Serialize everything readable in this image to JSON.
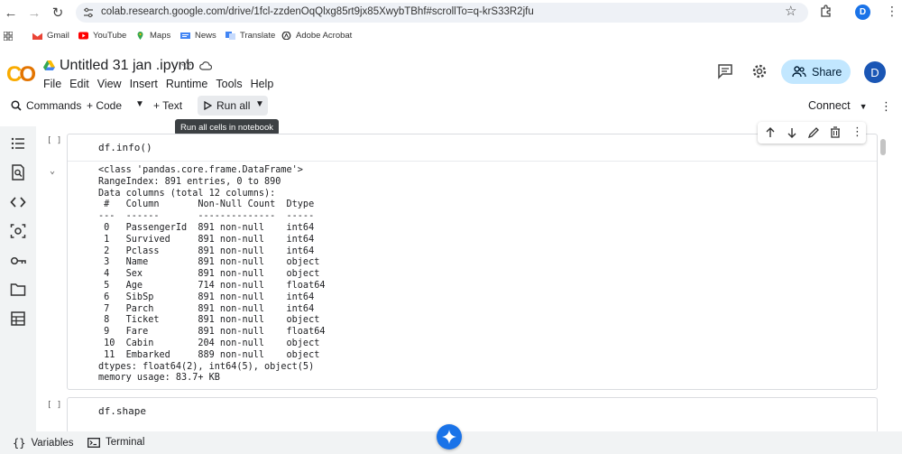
{
  "browser": {
    "url": "colab.research.google.com/drive/1fcl-zzdenOqQlxg85rt9jx85XwybTBhf#scrollTo=q-krS33R2jfu",
    "profile_initial": "D"
  },
  "bookmarks": [
    {
      "label": "Gmail",
      "icon": "gmail-icon"
    },
    {
      "label": "YouTube",
      "icon": "youtube-icon"
    },
    {
      "label": "Maps",
      "icon": "maps-icon"
    },
    {
      "label": "News",
      "icon": "news-icon"
    },
    {
      "label": "Translate",
      "icon": "translate-icon"
    },
    {
      "label": "Adobe Acrobat",
      "icon": "acrobat-icon"
    }
  ],
  "colab": {
    "logo_text": "CO",
    "title": "Untitled 31 jan .ipynb",
    "menu": [
      "File",
      "Edit",
      "View",
      "Insert",
      "Runtime",
      "Tools",
      "Help"
    ],
    "share_label": "Share",
    "user_initial": "D"
  },
  "toolbar": {
    "commands_label": "Commands",
    "code_label": "+ Code",
    "text_label": "+ Text",
    "run_all_label": "Run all",
    "tooltip": "Run all cells in notebook",
    "connect_label": "Connect"
  },
  "cells": [
    {
      "bracket": "[ ]",
      "code": "df.info()",
      "output": "<class 'pandas.core.frame.DataFrame'>\nRangeIndex: 891 entries, 0 to 890\nData columns (total 12 columns):\n #   Column       Non-Null Count  Dtype  \n---  ------       --------------  -----  \n 0   PassengerId  891 non-null    int64  \n 1   Survived     891 non-null    int64  \n 2   Pclass       891 non-null    int64  \n 3   Name         891 non-null    object \n 4   Sex          891 non-null    object \n 5   Age          714 non-null    float64\n 6   SibSp        891 non-null    int64  \n 7   Parch        891 non-null    int64  \n 8   Ticket       891 non-null    object \n 9   Fare         891 non-null    float64\n 10  Cabin        204 non-null    object \n 11  Embarked     889 non-null    object \ndtypes: float64(2), int64(5), object(5)\nmemory usage: 83.7+ KB"
    },
    {
      "bracket": "[ ]",
      "code": "df.shape"
    }
  ],
  "bottom": {
    "variables_label": "Variables",
    "terminal_label": "Terminal"
  }
}
